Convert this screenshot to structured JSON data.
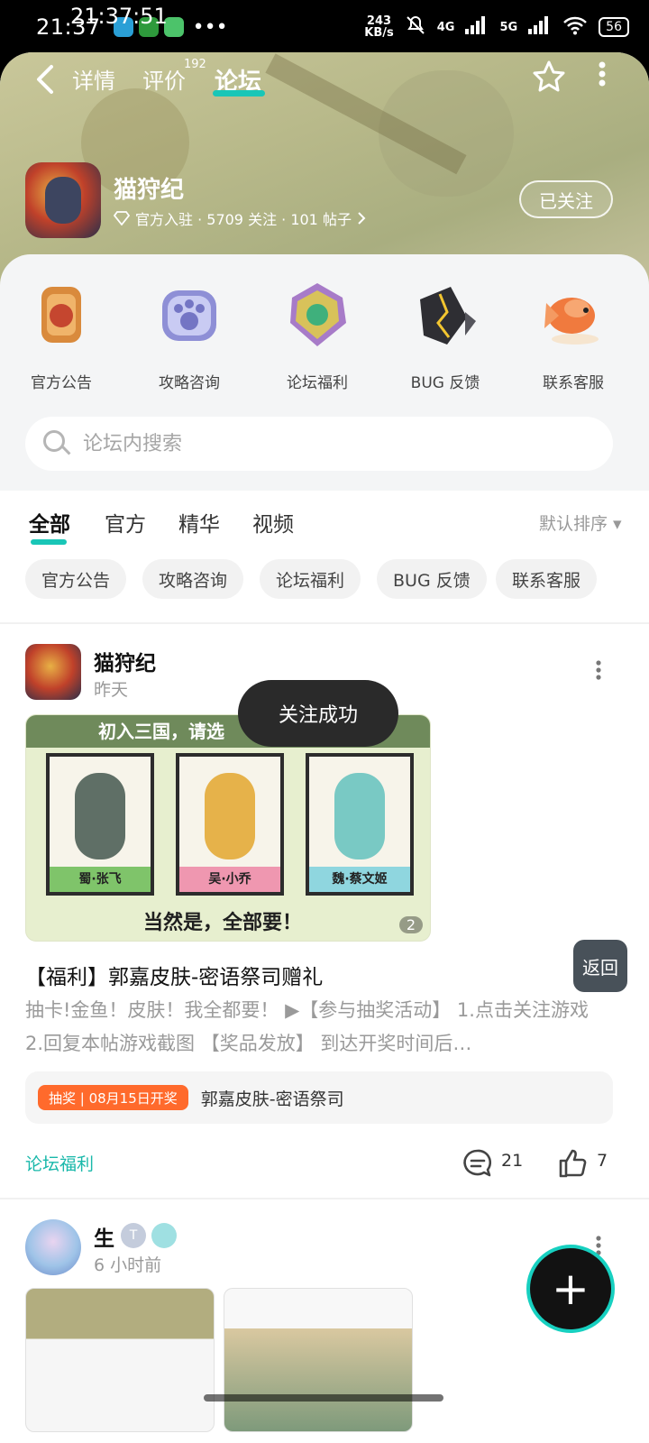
{
  "status_bar": {
    "time": "21:37",
    "time_overlay": "21:37:51",
    "dots": "•••",
    "net_speed_value": "243",
    "net_speed_unit": "KB/s",
    "signal1": "4G",
    "signal2": "5G",
    "battery": "56"
  },
  "nav": {
    "tabs": [
      {
        "label": "详情"
      },
      {
        "label": "评价",
        "count": "192"
      },
      {
        "label": "论坛"
      }
    ],
    "active_tab": "论坛"
  },
  "game": {
    "title": "猫狩纪",
    "meta": "官方入驻 · 5709 关注 · 101 帖子",
    "follow_label": "已关注"
  },
  "categories": [
    {
      "label": "官方公告",
      "icon": "scroll-icon"
    },
    {
      "label": "攻略咨询",
      "icon": "paw-icon"
    },
    {
      "label": "论坛福利",
      "icon": "gem-icon"
    },
    {
      "label": "BUG 反馈",
      "icon": "crystal-icon"
    },
    {
      "label": "联系客服",
      "icon": "koi-icon"
    }
  ],
  "search": {
    "placeholder": "论坛内搜索"
  },
  "feed_tabs": {
    "items": [
      "全部",
      "官方",
      "精华",
      "视频"
    ],
    "active": "全部",
    "sort": "默认排序 ▾"
  },
  "chips": [
    "官方公告",
    "攻略咨询",
    "论坛福利",
    "BUG 反馈",
    "联系客服"
  ],
  "post1": {
    "author": "猫狩纪",
    "time": "昨天",
    "image": {
      "header": "初入三国，请选",
      "cards": [
        "蜀·张飞",
        "吴·小乔",
        "魏·蔡文姬"
      ],
      "footer": "当然是，全部要！",
      "count": "2"
    },
    "title": "【福利】郭嘉皮肤-密语祭司赠礼",
    "body": "抽卡!金鱼！皮肤！我全都要！ ▶【参与抽奖活动】 1.点击关注游戏 2.回复本帖游戏截图 【奖品发放】 到达开奖时间后…",
    "lottery_tag": "抽奖 | 08月15日开奖",
    "lottery_text": "郭嘉皮肤-密语祭司",
    "board": "论坛福利",
    "comments": "21",
    "likes": "7"
  },
  "toast": "关注成功",
  "post2": {
    "author": "生",
    "badge": "T",
    "time": "6 小时前"
  },
  "return_label": "返回",
  "fab_label": "+",
  "colors": {
    "accent": "#19c6b7",
    "lottery": "#ff6a2c"
  }
}
